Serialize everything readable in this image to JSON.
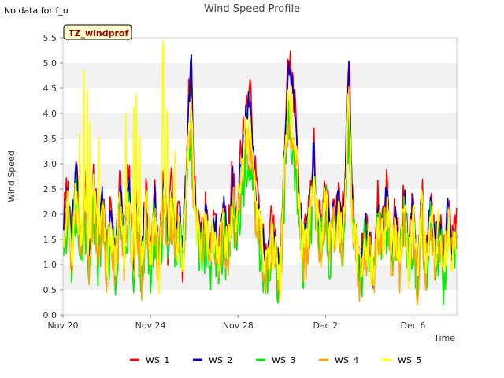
{
  "note": "No data for f_u",
  "chart_data": {
    "type": "line",
    "title": "Wind Speed Profile",
    "xlabel": "Time",
    "ylabel": "Wind Speed",
    "station_label": "TZ_windprof",
    "x_ticks": [
      "Nov 20",
      "Nov 24",
      "Nov 28",
      "Dec 2",
      "Dec 6"
    ],
    "x_range": [
      "Nov 20",
      "Dec 8"
    ],
    "ylim": [
      0.0,
      5.5
    ],
    "y_ticks": [
      "0.0",
      "0.5",
      "1.0",
      "1.5",
      "2.0",
      "2.5",
      "3.0",
      "3.5",
      "4.0",
      "4.5",
      "5.0",
      "5.5"
    ],
    "grid": "horizontal bands",
    "legend_position": "bottom",
    "series": [
      {
        "name": "WS_1",
        "color": "#ff0000",
        "scale": 1.0,
        "noise": 0.9
      },
      {
        "name": "WS_2",
        "color": "#0000cc",
        "scale": 0.96,
        "noise": 0.7
      },
      {
        "name": "WS_3",
        "color": "#00ee00",
        "scale": 0.74,
        "noise": 1.3
      },
      {
        "name": "WS_4",
        "color": "#ffa500",
        "scale": 0.78,
        "noise": 1.1
      },
      {
        "name": "WS_5",
        "color": "#ffff00",
        "scale": 0.85,
        "noise": 1.0
      }
    ],
    "base_profile": [
      [
        0.0,
        1.8
      ],
      [
        0.3,
        2.5
      ],
      [
        0.6,
        1.5
      ],
      [
        0.9,
        3.0
      ],
      [
        1.2,
        1.4
      ],
      [
        1.5,
        2.6
      ],
      [
        1.8,
        1.3
      ],
      [
        2.1,
        2.8
      ],
      [
        2.4,
        1.6
      ],
      [
        2.7,
        2.4
      ],
      [
        3.0,
        1.2
      ],
      [
        3.3,
        2.2
      ],
      [
        3.6,
        1.1
      ],
      [
        3.9,
        2.7
      ],
      [
        4.2,
        1.5
      ],
      [
        4.5,
        2.9
      ],
      [
        4.8,
        1.2
      ],
      [
        5.1,
        2.3
      ],
      [
        5.4,
        1.0
      ],
      [
        5.7,
        2.6
      ],
      [
        6.0,
        1.3
      ],
      [
        6.3,
        2.4
      ],
      [
        6.6,
        1.0
      ],
      [
        6.9,
        3.0
      ],
      [
        7.2,
        1.2
      ],
      [
        7.4,
        2.6
      ],
      [
        7.7,
        1.4
      ],
      [
        8.0,
        2.2
      ],
      [
        8.2,
        1.0
      ],
      [
        8.5,
        3.4
      ],
      [
        8.7,
        4.7
      ],
      [
        8.8,
        5.2
      ],
      [
        8.95,
        3.0
      ],
      [
        9.2,
        2.0
      ],
      [
        9.5,
        1.5
      ],
      [
        9.8,
        2.2
      ],
      [
        10.1,
        1.4
      ],
      [
        10.4,
        2.0
      ],
      [
        10.7,
        1.2
      ],
      [
        11.0,
        2.3
      ],
      [
        11.3,
        1.3
      ],
      [
        11.6,
        2.8
      ],
      [
        11.9,
        2.0
      ],
      [
        12.2,
        3.2
      ],
      [
        12.5,
        4.0
      ],
      [
        12.8,
        4.5
      ],
      [
        13.1,
        3.0
      ],
      [
        13.4,
        2.2
      ],
      [
        13.7,
        1.5
      ],
      [
        14.0,
        0.9
      ],
      [
        14.3,
        1.9
      ],
      [
        14.6,
        1.2
      ],
      [
        14.9,
        0.8
      ],
      [
        15.2,
        3.5
      ],
      [
        15.5,
        5.3
      ],
      [
        16.0,
        3.8
      ],
      [
        16.4,
        1.5
      ],
      [
        16.7,
        1.6
      ],
      [
        17.0,
        2.5
      ],
      [
        17.2,
        3.5
      ],
      [
        17.4,
        2.2
      ],
      [
        17.7,
        1.8
      ],
      [
        18.0,
        2.8
      ],
      [
        18.3,
        1.6
      ],
      [
        18.5,
        2.2
      ],
      [
        18.7,
        1.7
      ],
      [
        18.9,
        2.5
      ],
      [
        19.1,
        1.8
      ],
      [
        19.3,
        2.4
      ],
      [
        19.6,
        5.4
      ],
      [
        19.8,
        2.5
      ],
      [
        20.1,
        1.5
      ],
      [
        20.4,
        0.9
      ],
      [
        20.7,
        1.8
      ],
      [
        21.0,
        1.5
      ],
      [
        21.3,
        0.8
      ],
      [
        21.6,
        2.3
      ],
      [
        21.9,
        1.7
      ],
      [
        22.2,
        2.5
      ],
      [
        22.5,
        1.4
      ],
      [
        22.8,
        2.0
      ],
      [
        23.1,
        1.2
      ],
      [
        23.4,
        2.6
      ],
      [
        23.7,
        1.1
      ],
      [
        24.0,
        2.4
      ],
      [
        24.3,
        0.8
      ],
      [
        24.6,
        2.5
      ],
      [
        24.9,
        1.2
      ],
      [
        25.2,
        2.4
      ],
      [
        25.5,
        1.5
      ],
      [
        25.8,
        2.0
      ],
      [
        26.1,
        1.0
      ],
      [
        26.4,
        2.2
      ],
      [
        26.7,
        1.3
      ],
      [
        27.0,
        2.0
      ]
    ]
  },
  "legend": {
    "items": [
      "WS_1",
      "WS_2",
      "WS_3",
      "WS_4",
      "WS_5"
    ]
  }
}
